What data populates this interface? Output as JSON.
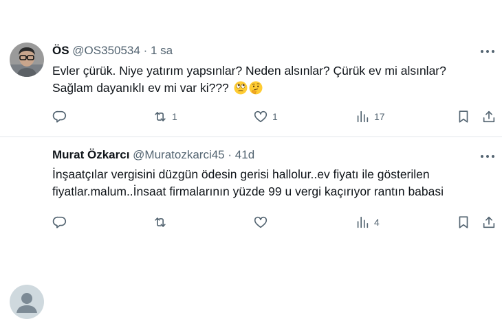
{
  "tweets": [
    {
      "author": "ÖS",
      "handle": "@OS350534",
      "separator": "·",
      "time": "1 sa",
      "text_lines": [
        "Evler çürük. Niye yatırım yapsınlar? Neden alsınlar? Çürük ev mi alsınlar?",
        "Sağlam dayanıklı ev mi var ki???"
      ],
      "emojis": [
        "rolling-eyes-emoji",
        "thinking-face-emoji"
      ],
      "actions": {
        "reply_count": "",
        "retweet_count": "1",
        "like_count": "1",
        "view_count": "17"
      }
    },
    {
      "author": "Murat Özkarcı",
      "handle": "@Muratozkarci45",
      "separator": "·",
      "time": "41d",
      "text_lines": [
        "İnşaatçılar vergisini düzgün ödesin gerisi hallolur..ev fiyatı ile gösterilen",
        "fiyatlar.malum..İnsaat firmalarının yüzde 99 u vergi kaçırıyor rantın babasi"
      ],
      "actions": {
        "reply_count": "",
        "retweet_count": "",
        "like_count": "",
        "view_count": "4"
      }
    }
  ],
  "colors": {
    "text": "#0f1419",
    "secondary": "#536471",
    "divider": "#e1e6ea",
    "default_avatar_bg": "#cfd9de"
  },
  "icons": [
    "reply-icon",
    "retweet-icon",
    "like-icon",
    "views-icon",
    "bookmark-icon",
    "share-icon",
    "more-icon"
  ]
}
